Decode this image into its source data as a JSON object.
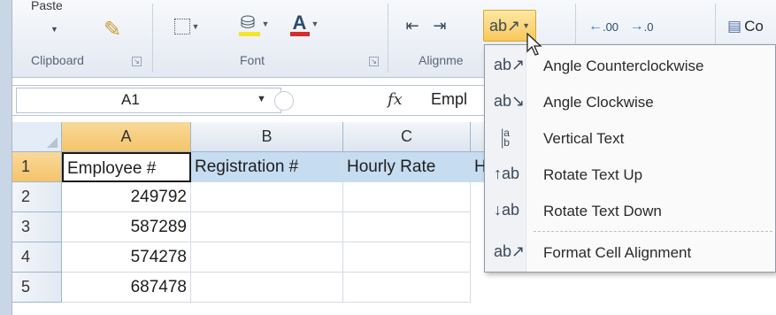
{
  "ribbon": {
    "paste_label": "Paste",
    "groups": {
      "clipboard": "Clipboard",
      "font": "Font",
      "alignment": "Alignme"
    },
    "number_format": {
      "increase_decimal": ".00",
      "decrease_decimal": ".0"
    },
    "cells_partial": "Co",
    "accent_colors": {
      "font_color": "#d82b2b",
      "highlight": "#f5e42a",
      "pressed": "#f8c95b"
    }
  },
  "formula_bar": {
    "name_box": "A1",
    "fx_label": "fx",
    "content": "Empl"
  },
  "grid": {
    "columns": [
      "A",
      "B",
      "C"
    ],
    "rows": [
      "1",
      "2",
      "3",
      "4",
      "5"
    ],
    "cells": {
      "A1": "Employee #",
      "B1": "Registration #",
      "C1": "Hourly Rate",
      "D1": "H",
      "A2": "249792",
      "A3": "587289",
      "A4": "574278",
      "A5": "687478"
    }
  },
  "orientation_menu": {
    "items": [
      {
        "label": "Angle Counterclockwise",
        "icon": "angle-counterclockwise-icon"
      },
      {
        "label": "Angle Clockwise",
        "icon": "angle-clockwise-icon"
      },
      {
        "label": "Vertical Text",
        "icon": "vertical-text-icon"
      },
      {
        "label": "Rotate Text Up",
        "icon": "rotate-text-up-icon"
      },
      {
        "label": "Rotate Text Down",
        "icon": "rotate-text-down-icon"
      },
      {
        "label": "Format Cell Alignment",
        "icon": "format-cell-alignment-icon"
      }
    ]
  }
}
